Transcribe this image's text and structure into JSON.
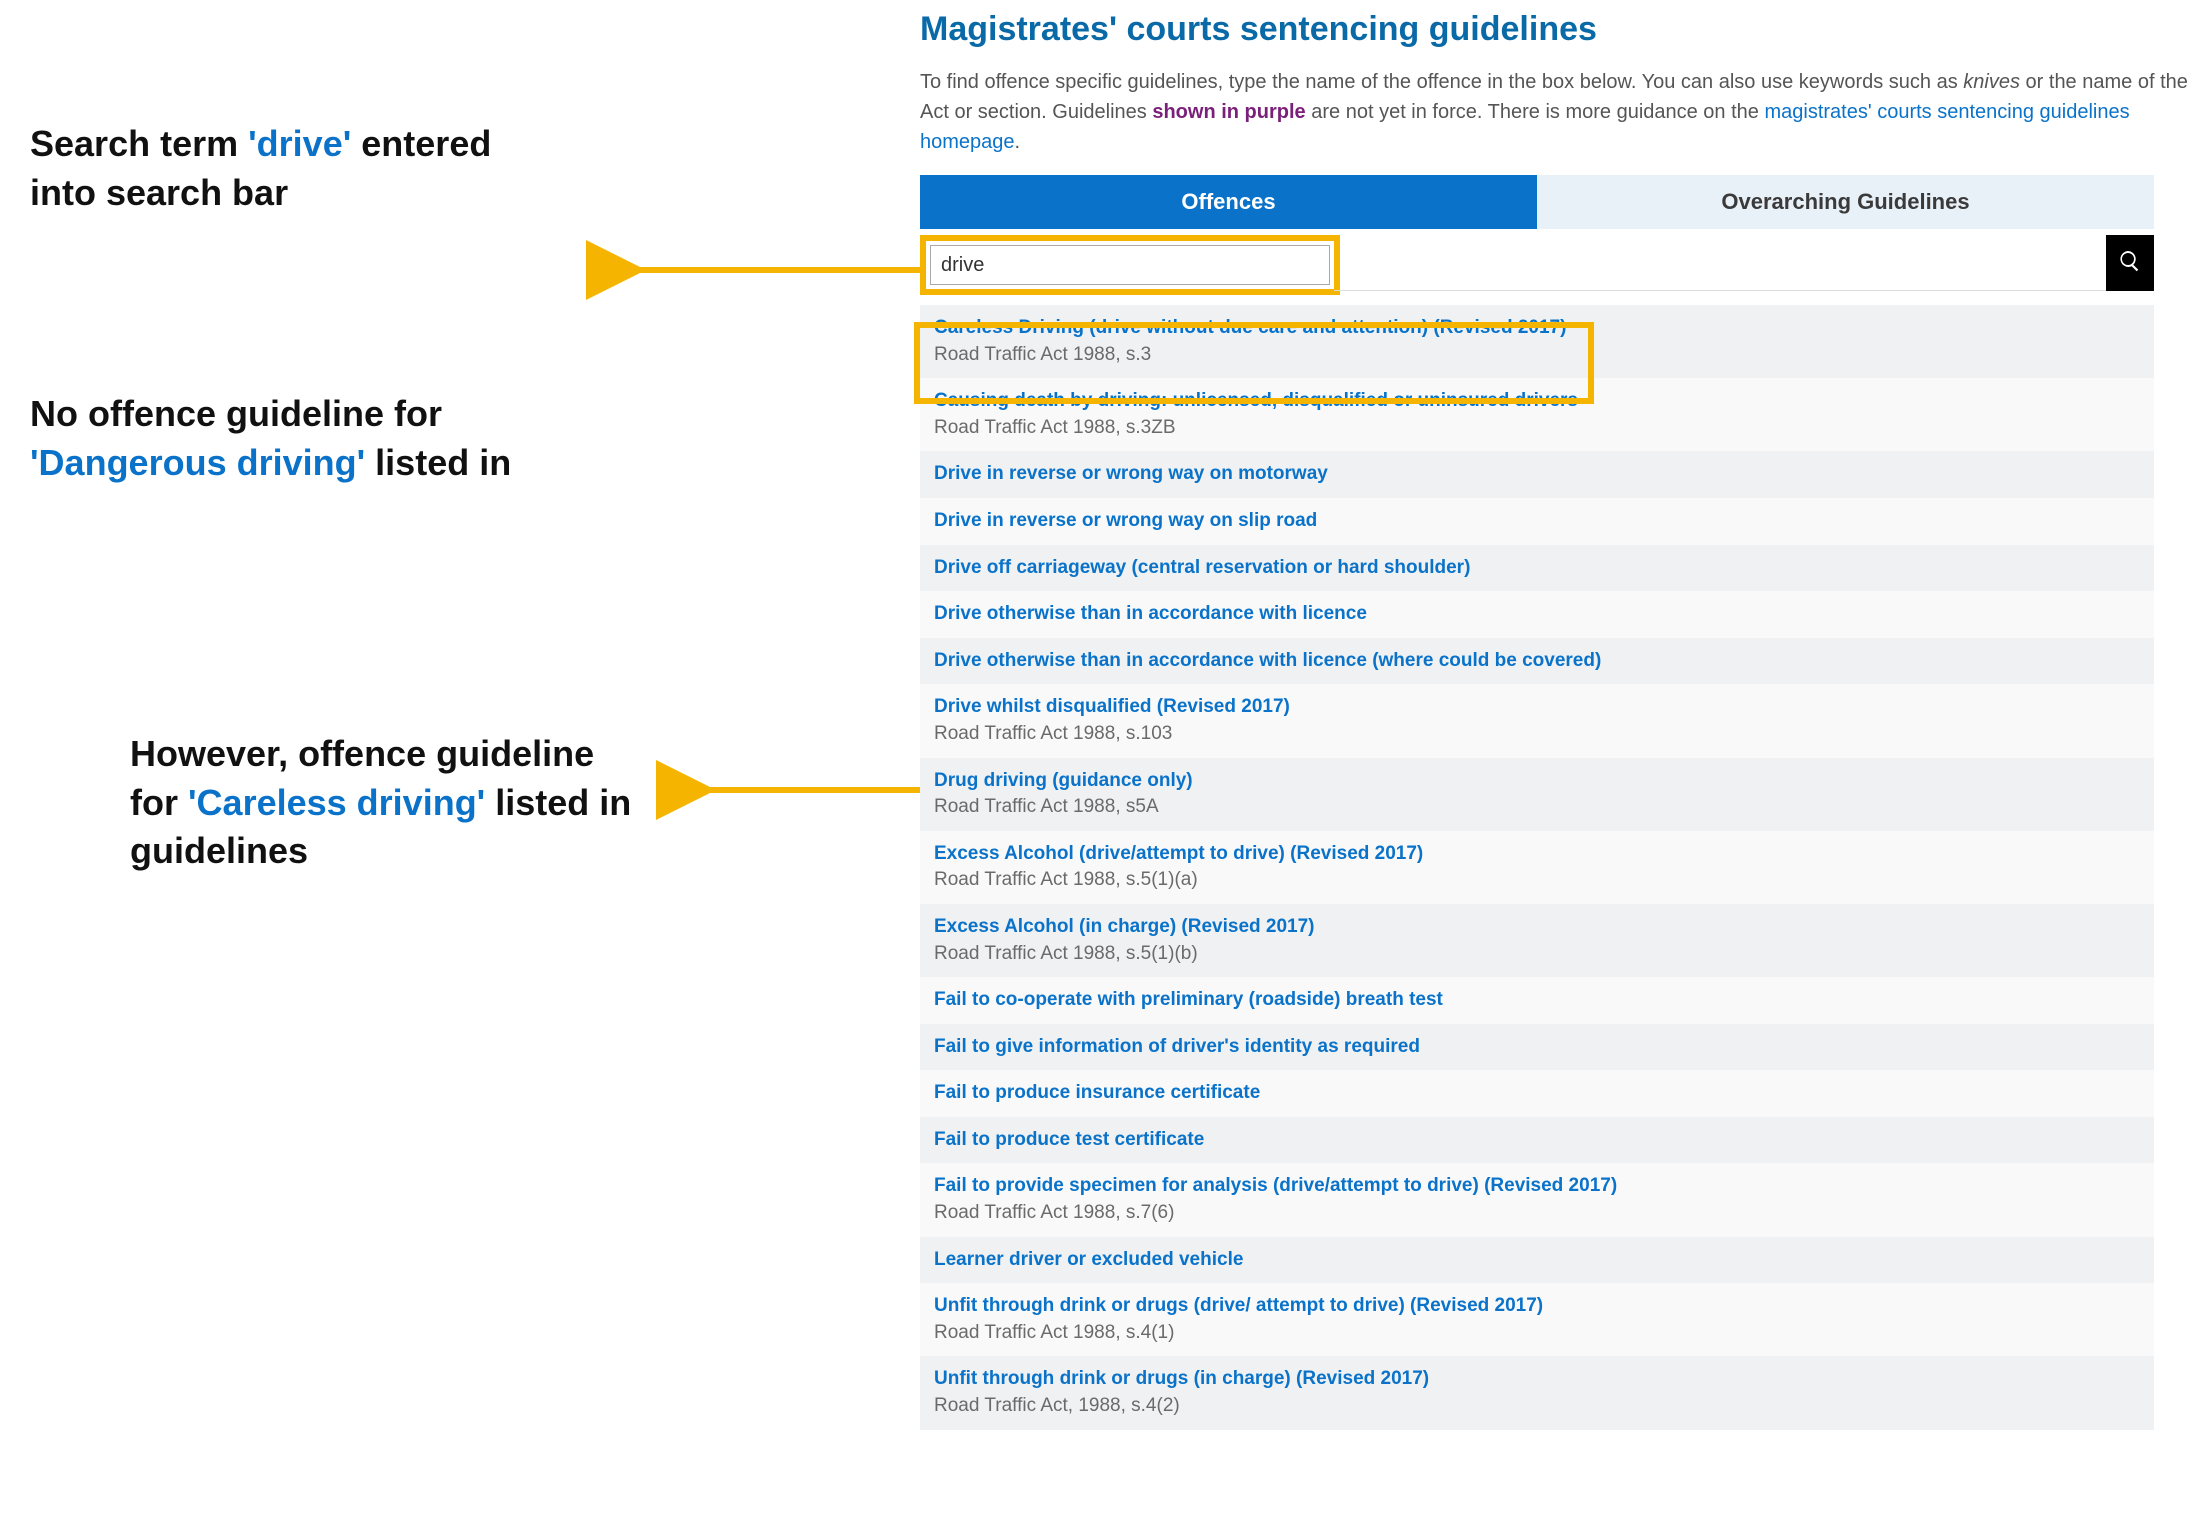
{
  "annotations": {
    "a1_pre": "Search term ",
    "a1_hl": "'drive'",
    "a1_post1": " entered into search bar",
    "a2_pre": "No offence guideline for ",
    "a2_hl": "'Dangerous driving'",
    "a2_post": " listed in",
    "a3_pre": "However, offence guideline for ",
    "a3_hl": "'Careless driving'",
    "a3_post": " listed in guidelines"
  },
  "page": {
    "title": "Magistrates' courts sentencing guidelines",
    "intro_part1": "To find offence specific guidelines, type the name of the offence in the box below. You can also use keywords such as ",
    "intro_em": "knives",
    "intro_part2": " or the name of the Act or section. Guidelines ",
    "intro_purple": "shown in purple",
    "intro_part3": " are not yet in force. There is more guidance on the ",
    "intro_link": "magistrates' courts sentencing guidelines homepage",
    "intro_end": "."
  },
  "tabs": {
    "active": "Offences",
    "inactive": "Overarching Guidelines"
  },
  "search": {
    "value": "drive"
  },
  "results": [
    {
      "title": "Careless Driving (drive without due care and attention) (Revised 2017)",
      "sub": "Road Traffic Act 1988, s.3"
    },
    {
      "title": "Causing death by driving: unlicensed, disqualified or uninsured drivers",
      "sub": "Road Traffic Act 1988, s.3ZB"
    },
    {
      "title": "Drive in reverse or wrong way on motorway",
      "sub": ""
    },
    {
      "title": "Drive in reverse or wrong way on slip road",
      "sub": ""
    },
    {
      "title": "Drive off carriageway (central reservation or hard shoulder)",
      "sub": ""
    },
    {
      "title": "Drive otherwise than in accordance with licence",
      "sub": ""
    },
    {
      "title": "Drive otherwise than in accordance with licence (where could be covered)",
      "sub": ""
    },
    {
      "title": "Drive whilst disqualified (Revised 2017)",
      "sub": "Road Traffic Act 1988, s.103"
    },
    {
      "title": "Drug driving (guidance only)",
      "sub": "Road Traffic Act 1988, s5A"
    },
    {
      "title": "Excess Alcohol (drive/attempt to drive) (Revised 2017)",
      "sub": "Road Traffic Act 1988, s.5(1)(a)"
    },
    {
      "title": "Excess Alcohol (in charge) (Revised 2017)",
      "sub": "Road Traffic Act 1988, s.5(1)(b)"
    },
    {
      "title": "Fail to co-operate with preliminary (roadside) breath test",
      "sub": ""
    },
    {
      "title": "Fail to give information of driver's identity as required",
      "sub": ""
    },
    {
      "title": "Fail to produce insurance certificate",
      "sub": ""
    },
    {
      "title": "Fail to produce test certificate",
      "sub": ""
    },
    {
      "title": "Fail to provide specimen for analysis (drive/attempt to drive) (Revised 2017)",
      "sub": "Road Traffic Act 1988, s.7(6)"
    },
    {
      "title": "Learner driver or excluded vehicle",
      "sub": ""
    },
    {
      "title": "Unfit through drink or drugs (drive/ attempt to drive) (Revised 2017)",
      "sub": "Road Traffic Act 1988, s.4(1)"
    },
    {
      "title": "Unfit through drink or drugs (in charge) (Revised 2017)",
      "sub": "Road Traffic Act, 1988, s.4(2)"
    }
  ]
}
